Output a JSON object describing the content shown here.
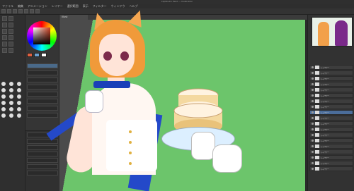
{
  "window": {
    "title": "ClipStudio Paint — Illustration"
  },
  "menu": [
    "ファイル",
    "編集",
    "アニメーション",
    "レイヤー",
    "選択範囲",
    "表示",
    "フィルター",
    "ウィンドウ",
    "ヘルプ"
  ],
  "canvas_tab": {
    "label": "illust"
  },
  "colors": {
    "canvas_bg": "#6cc56b",
    "accent": "#4b6d9a",
    "main_color": "#d04020"
  },
  "swatches": [
    "#e06040",
    "#6aa0d0",
    "#ffffff"
  ],
  "layers": [
    {
      "name": "レイヤー"
    },
    {
      "name": "レイヤー"
    },
    {
      "name": "レイヤー"
    },
    {
      "name": "レイヤー"
    },
    {
      "name": "レイヤー"
    },
    {
      "name": "レイヤー"
    },
    {
      "name": "レイヤー"
    },
    {
      "name": "レイヤー"
    },
    {
      "name": "レイヤー"
    },
    {
      "name": "レイヤー"
    },
    {
      "name": "レイヤー"
    },
    {
      "name": "レイヤー"
    },
    {
      "name": "レイヤー"
    },
    {
      "name": "レイヤー"
    },
    {
      "name": "レイヤー"
    },
    {
      "name": "レイヤー"
    },
    {
      "name": "レイヤー"
    },
    {
      "name": "レイヤー"
    },
    {
      "name": "レイヤー"
    }
  ]
}
